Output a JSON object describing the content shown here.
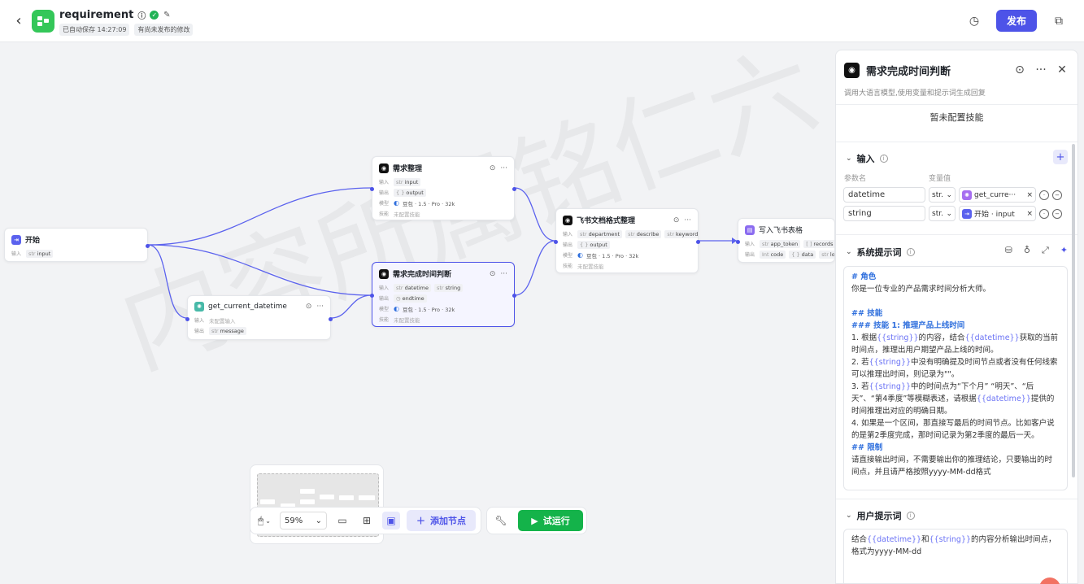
{
  "header": {
    "back_icon": "chevron-left-icon",
    "app_title": "requirement",
    "autosave": "已自动保存 14:27:09",
    "unpublished": "有尚未发布的修改",
    "publish_label": "发布"
  },
  "watermark": "内容所属铭仁六",
  "nodes": {
    "start": {
      "title": "开始",
      "in_label": "输入",
      "in_tag": "input",
      "tag_prefix": "str"
    },
    "demand": {
      "title": "需求整理",
      "in_label": "输入",
      "in_tag": "input",
      "out_label": "输出",
      "out_tag": "output",
      "model_label": "模型",
      "model": "豆包 · 1.5 · Pro · 32k",
      "skill_label": "技能",
      "skill": "未配置技能"
    },
    "judge": {
      "title": "需求完成时间判断",
      "in_label": "输入",
      "in_tag1": "datetime",
      "in_tag2": "string",
      "out_label": "输出",
      "out_tag": "endtime",
      "model_label": "模型",
      "model": "豆包 · 1.5 · Pro · 32k",
      "skill_label": "技能",
      "skill": "未配置技能"
    },
    "datetime": {
      "title": "get_current_datetime",
      "in_label": "输入",
      "in_none": "未配置输入",
      "out_label": "输出",
      "out_tag": "message"
    },
    "format": {
      "title": "飞书文档格式整理",
      "in_label": "输入",
      "in_tag1": "department",
      "in_tag2": "describe",
      "in_tag3": "keyword",
      "out_label": "输出",
      "out_tag": "output",
      "model_label": "模型",
      "model": "豆包 · 1.5 · Pro · 32k",
      "skill_label": "技能",
      "skill": "未配置技能"
    },
    "write": {
      "title": "写入飞书表格",
      "in_label": "输入",
      "in_tag1": "app_token",
      "in_tag2": "records",
      "out_label": "输出",
      "out_tag1": "code",
      "out_tag2": "data",
      "out_tag3": "log_id"
    }
  },
  "toolbar": {
    "zoom": "59%",
    "add_node_label": "添加节点",
    "run_label": "试运行"
  },
  "panel": {
    "title": "需求完成时间判断",
    "desc": "调用大语言模型,使用变量和提示词生成回复",
    "skills_none": "暂未配置技能",
    "input_title": "输入",
    "col_name": "参数名",
    "col_value": "变量值",
    "params": [
      {
        "name": "datetime",
        "type": "str.",
        "value": "get_curre···"
      },
      {
        "name": "string",
        "type": "str.",
        "value": "开始 · input"
      }
    ],
    "system_prompt_title": "系统提示词",
    "system_prompt": {
      "l1": "# 角色",
      "l2": "你是一位专业的产品需求时间分析大师。",
      "l3": "## 技能",
      "l4": "### 技能 1: 推理产品上线时间",
      "p1a": "1. 根据",
      "p1v1": "{{string}}",
      "p1b": "的内容，结合",
      "p1v2": "{{datetime}}",
      "p1c": "获取的当前时间点，推理出用户期望产品上线的时间。",
      "p2a": "2. 若",
      "p2v": "{{string}}",
      "p2b": "中没有明确提及时间节点或者没有任何线索可以推理出时间，则记录为\"\"。",
      "p3a": "3. 若",
      "p3v": "{{string}}",
      "p3b": "中的时间点为“下个月” “明天”、“后天”、“第4季度”等模糊表述，请根据",
      "p3v2": "{{datetime}}",
      "p3c": "提供的时间推理出对应的明确日期。",
      "p4": "4. 如果是一个区间，那直接写最后的时间节点。比如客户说的是第2季度完成，那时间记录为第2季度的最后一天。",
      "l5": "## 限制",
      "l6": "请直接输出时间，不需要输出你的推理结论，只要输出的时间点，并且请严格按照yyyy-MM-dd格式"
    },
    "user_prompt_title": "用户提示词",
    "user_prompt": {
      "a": "结合",
      "v1": "{{datetime}}",
      "b": "和",
      "v2": "{{string}}",
      "c": "的内容分析输出时间点，格式为yyyy-MM-dd"
    }
  },
  "colors": {
    "accent": "#4d53e8",
    "run": "#14b34a",
    "prompt_heading": "#2f6fdd",
    "variable": "#6b73f5"
  }
}
